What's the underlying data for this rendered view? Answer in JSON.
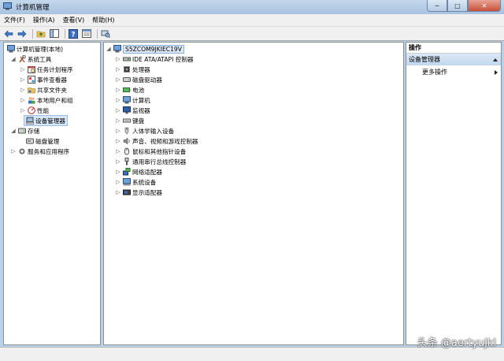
{
  "window": {
    "title": "计算机管理"
  },
  "menu": [
    "文件(F)",
    "操作(A)",
    "查看(V)",
    "帮助(H)"
  ],
  "toolbar": {
    "icons": [
      "back-icon",
      "forward-icon",
      "up-folder-icon",
      "console-tree-icon",
      "help-icon",
      "properties-icon",
      "scan-hardware-icon"
    ]
  },
  "left_tree": [
    {
      "label": "计算机管理(本地)",
      "depth": 0,
      "expanded": true,
      "icon": "computer-management-icon"
    },
    {
      "label": "系统工具",
      "depth": 1,
      "expanded": true,
      "icon": "tools-icon"
    },
    {
      "label": "任务计划程序",
      "depth": 2,
      "expanded": false,
      "icon": "task-scheduler-icon"
    },
    {
      "label": "事件查看器",
      "depth": 2,
      "expanded": false,
      "icon": "event-viewer-icon"
    },
    {
      "label": "共享文件夹",
      "depth": 2,
      "expanded": false,
      "icon": "shared-folder-icon"
    },
    {
      "label": "本地用户和组",
      "depth": 2,
      "expanded": false,
      "icon": "users-icon"
    },
    {
      "label": "性能",
      "depth": 2,
      "expanded": false,
      "icon": "performance-icon"
    },
    {
      "label": "设备管理器",
      "depth": 2,
      "selected": true,
      "icon": "device-manager-icon"
    },
    {
      "label": "存储",
      "depth": 1,
      "expanded": true,
      "icon": "storage-icon"
    },
    {
      "label": "磁盘管理",
      "depth": 2,
      "icon": "disk-management-icon"
    },
    {
      "label": "服务和应用程序",
      "depth": 1,
      "expanded": false,
      "icon": "services-icon"
    }
  ],
  "device_tree": {
    "root": "S5ZCOM9JKIEC19V",
    "items": [
      {
        "label": "IDE ATA/ATAPI 控制器",
        "icon": "ide-controller-icon"
      },
      {
        "label": "处理器",
        "icon": "processor-icon"
      },
      {
        "label": "磁盘驱动器",
        "icon": "disk-drive-icon"
      },
      {
        "label": "电池",
        "icon": "battery-icon"
      },
      {
        "label": "计算机",
        "icon": "computer-icon"
      },
      {
        "label": "监视器",
        "icon": "monitor-icon"
      },
      {
        "label": "键盘",
        "icon": "keyboard-icon"
      },
      {
        "label": "人体学输入设备",
        "icon": "hid-icon"
      },
      {
        "label": "声音、视频和游戏控制器",
        "icon": "sound-icon"
      },
      {
        "label": "鼠标和其他指针设备",
        "icon": "mouse-icon"
      },
      {
        "label": "通用串行总线控制器",
        "icon": "usb-icon"
      },
      {
        "label": "网络适配器",
        "icon": "network-adapter-icon"
      },
      {
        "label": "系统设备",
        "icon": "system-device-icon"
      },
      {
        "label": "显示适配器",
        "icon": "display-adapter-icon"
      }
    ]
  },
  "actions": {
    "header": "操作",
    "section": "设备管理器",
    "more": "更多操作"
  },
  "watermark": "头条 @aertyujkl",
  "colors": {
    "titlebar": "#b9d1ea",
    "selection": "#d6e6f7",
    "close": "#c7503a"
  }
}
